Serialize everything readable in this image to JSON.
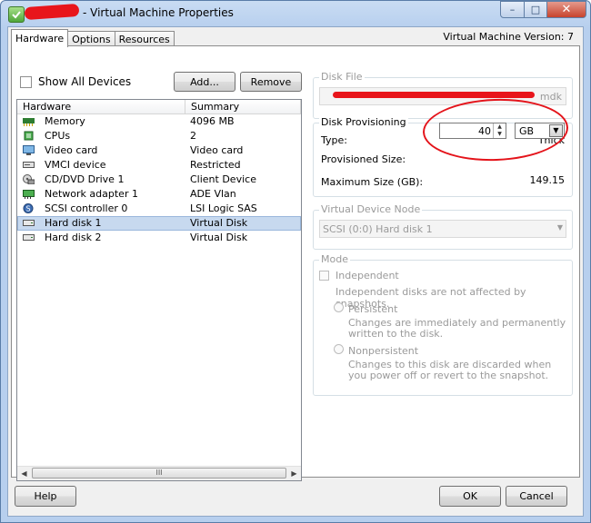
{
  "window": {
    "title": "- Virtual Machine Properties",
    "controls": {
      "minimize": "–",
      "maximize": "□",
      "close": "✕"
    }
  },
  "tabs": [
    {
      "label": "Hardware",
      "active": true
    },
    {
      "label": "Options",
      "active": false
    },
    {
      "label": "Resources",
      "active": false
    }
  ],
  "vm_version": "Virtual Machine Version: 7",
  "hardware": {
    "show_all_devices_label": "Show All Devices",
    "show_all_devices_checked": false,
    "add_button": "Add...",
    "remove_button": "Remove",
    "columns": [
      "Hardware",
      "Summary"
    ],
    "rows": [
      {
        "icon": "memory-icon",
        "name": "Memory",
        "summary": "4096 MB",
        "selected": false
      },
      {
        "icon": "cpu-icon",
        "name": "CPUs",
        "summary": "2",
        "selected": false
      },
      {
        "icon": "monitor-icon",
        "name": "Video card",
        "summary": "Video card",
        "selected": false
      },
      {
        "icon": "device-icon",
        "name": "VMCI device",
        "summary": "Restricted",
        "selected": false
      },
      {
        "icon": "cd-drive-icon",
        "name": "CD/DVD Drive 1",
        "summary": "Client Device",
        "selected": false
      },
      {
        "icon": "network-adapter-icon",
        "name": "Network adapter 1",
        "summary": "ADE Vlan",
        "selected": false
      },
      {
        "icon": "scsi-controller-icon",
        "name": "SCSI controller 0",
        "summary": "LSI Logic SAS",
        "selected": false
      },
      {
        "icon": "hard-disk-icon",
        "name": "Hard disk 1",
        "summary": "Virtual Disk",
        "selected": true
      },
      {
        "icon": "hard-disk-icon",
        "name": "Hard disk 2",
        "summary": "Virtual Disk",
        "selected": false
      }
    ],
    "scrollbar_grip": "III"
  },
  "disk_file": {
    "title": "Disk File",
    "value_suffix": "mdk"
  },
  "disk_provisioning": {
    "title": "Disk Provisioning",
    "type_label": "Type:",
    "type_value": "Thick",
    "provisioned_size_label": "Provisioned Size:",
    "provisioned_size_value": "40",
    "unit": "GB",
    "max_size_label": "Maximum Size (GB):",
    "max_size_value": "149.15"
  },
  "virtual_device_node": {
    "title": "Virtual Device Node",
    "value": "SCSI (0:0) Hard disk 1"
  },
  "mode": {
    "title": "Mode",
    "independent_label": "Independent",
    "independent_desc": "Independent disks are not affected by snapshots.",
    "persistent_label": "Persistent",
    "persistent_desc": "Changes are immediately and permanently written to the disk.",
    "nonpersistent_label": "Nonpersistent",
    "nonpersistent_desc": "Changes to this disk are discarded when you power off or revert to the snapshot."
  },
  "footer": {
    "help": "Help",
    "ok": "OK",
    "cancel": "Cancel"
  },
  "colors": {
    "selection": "#c7d9ef",
    "annotation_red": "#e4131a",
    "title_gradient": "#b7cfee"
  }
}
